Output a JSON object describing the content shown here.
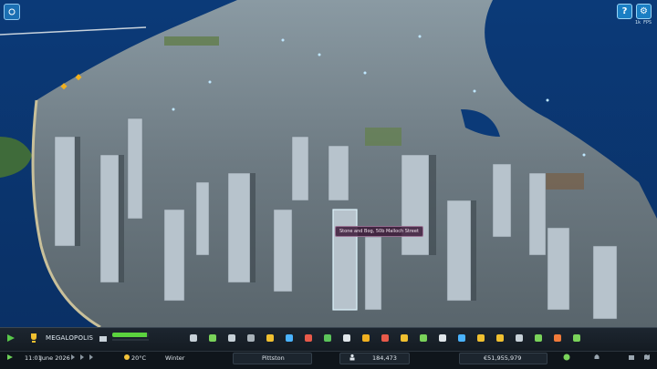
{
  "hud": {
    "fps_label": "1k FPS",
    "tooltip": "Stone and Bog, 50b Malloch Street",
    "help_icon": "question-icon",
    "settings_icon": "gear-icon"
  },
  "toolbar": {
    "city_name": "MEGALOPOLIS",
    "progress_fraction": 0.95,
    "tools": [
      "roads-icon",
      "zoning-icon",
      "areas-icon",
      "terrain-icon",
      "electricity-icon",
      "water-icon",
      "healthcare-icon",
      "garbage-icon",
      "education-icon",
      "police-icon",
      "fire-icon",
      "transport-icon",
      "parks-icon",
      "communication-icon",
      "landmark-icon",
      "economy-icon",
      "money-icon",
      "statistics-icon",
      "map-icon",
      "chart-icon",
      "tree-icon"
    ]
  },
  "status": {
    "time": "11:01",
    "date": "June 2026",
    "temperature": "20°C",
    "season": "Winter",
    "location": "Pittston",
    "population": "184,473",
    "money": "€51,955,979"
  },
  "colors": {
    "accent": "#1a7fc4",
    "progress": "#5bd33e",
    "toolbar_bg": "#18202a"
  }
}
